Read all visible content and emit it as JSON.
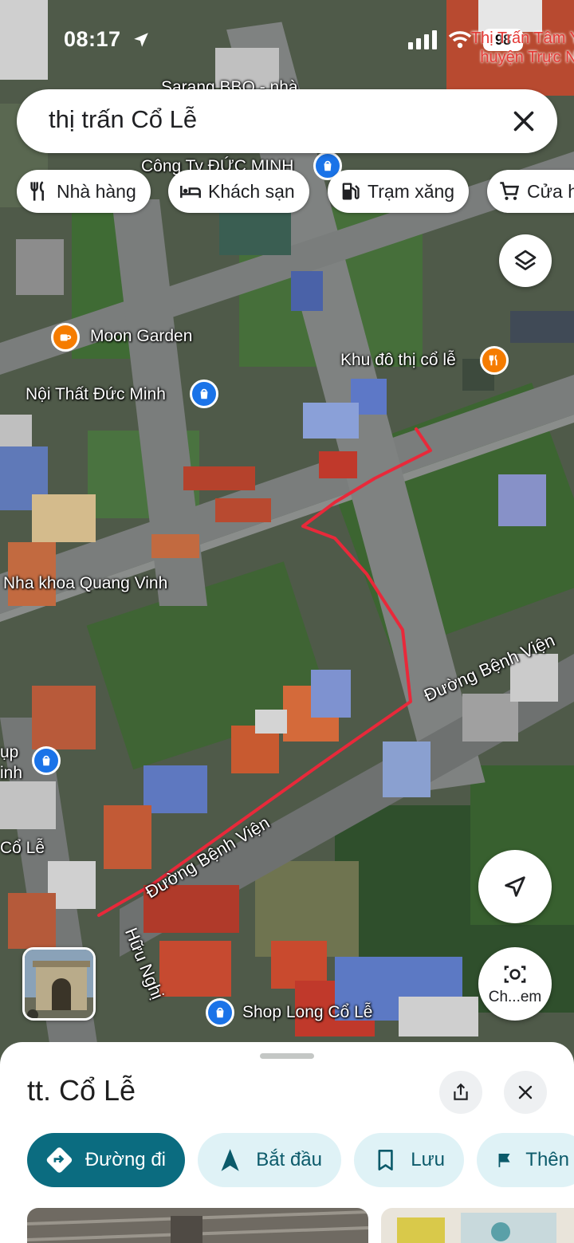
{
  "status_bar": {
    "time": "08:17",
    "battery": "98",
    "corner_label_line1": "Thị Trấn Tâm Y",
    "corner_label_line2": "huyện Trực Ni"
  },
  "search": {
    "query": "thị trấn Cổ Lễ"
  },
  "chips": [
    {
      "label": "Nhà hàng",
      "icon": "restaurant-icon"
    },
    {
      "label": "Khách sạn",
      "icon": "hotel-icon"
    },
    {
      "label": "Trạm xăng",
      "icon": "gas-station-icon"
    },
    {
      "label": "Cửa h",
      "icon": "shopping-cart-icon"
    }
  ],
  "map": {
    "labels": {
      "top_partial": "Sarang BBQ - nhà",
      "cong_ty": "Công Ty ĐỨC MINH",
      "moon_garden": "Moon Garden",
      "khu_do_thi": "Khu đô thị cổ lễ",
      "noi_that": "Nội Thất Đức Minh",
      "nha_khoa": "Nha khoa Quang Vinh",
      "duong_benh_vien_upper": "Đường Bệnh Viện",
      "duong_benh_vien_lower": "Đường Bệnh Viện",
      "huu_nghi": "Hữu Nghị",
      "shop_long": "Shop Long Cổ Lễ",
      "left_edge_1": "ụp",
      "left_edge_2": "inh",
      "left_edge_3": "Cổ Lễ"
    },
    "route_color": "#e8293a"
  },
  "lens_button": {
    "label": "Ch...em"
  },
  "sheet": {
    "title": "tt. Cổ Lễ",
    "actions": [
      {
        "label": "Đường đi",
        "icon": "directions-icon"
      },
      {
        "label": "Bắt đầu",
        "icon": "navigation-arrow-icon"
      },
      {
        "label": "Lưu",
        "icon": "bookmark-icon"
      },
      {
        "label": "Thên",
        "icon": "flag-icon"
      }
    ]
  },
  "colors": {
    "primary_action": "#0b6c80",
    "secondary_action_bg": "#dff2f6",
    "pin_blue": "#1a73e8",
    "pin_orange": "#f57c00"
  }
}
